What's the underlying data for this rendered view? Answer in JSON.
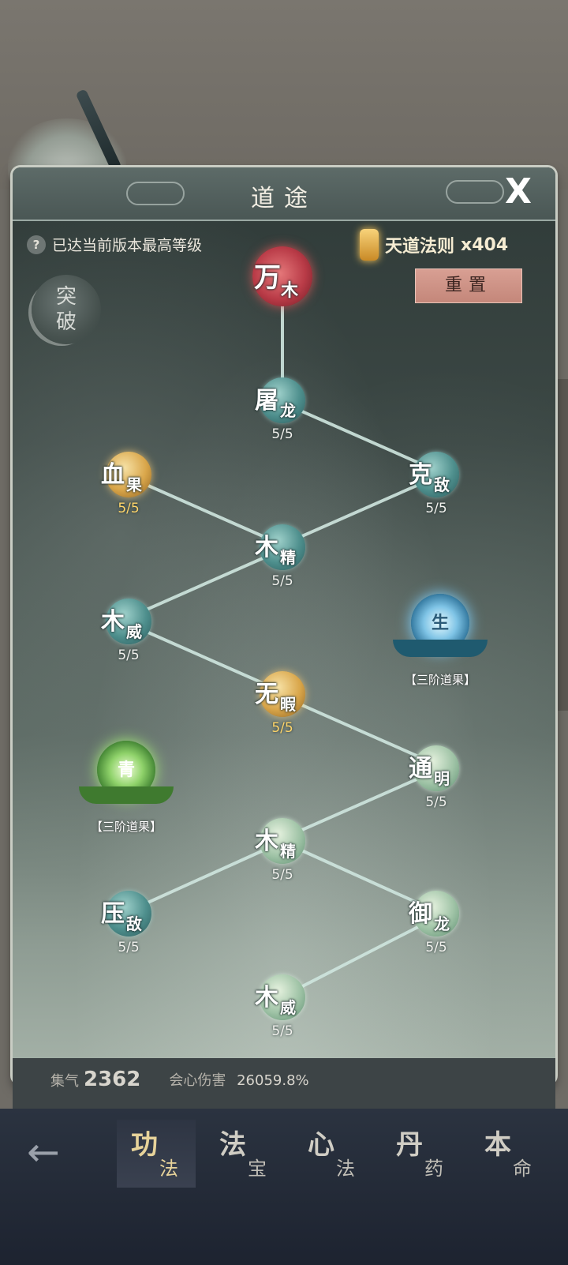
{
  "panel": {
    "title": "道途",
    "close_label": "X",
    "info_text": "已达当前版本最高等级",
    "help_icon_label": "?",
    "currency": {
      "name": "天道法则",
      "amount": "x404"
    },
    "reset_label": "重置",
    "breakthrough_top": "突",
    "breakthrough_bottom": "破"
  },
  "nodes": [
    {
      "c1": "万",
      "c2": "木",
      "level": ""
    },
    {
      "c1": "屠",
      "c2": "龙",
      "level": "5/5"
    },
    {
      "c1": "血",
      "c2": "果",
      "level": "5/5"
    },
    {
      "c1": "克",
      "c2": "敌",
      "level": "5/5"
    },
    {
      "c1": "木",
      "c2": "精",
      "level": "5/5"
    },
    {
      "c1": "木",
      "c2": "威",
      "level": "5/5"
    },
    {
      "c1": "无",
      "c2": "暇",
      "level": "5/5"
    },
    {
      "c1": "通",
      "c2": "明",
      "level": "5/5"
    },
    {
      "c1": "木",
      "c2": "精",
      "level": "5/5"
    },
    {
      "c1": "压",
      "c2": "敌",
      "level": "5/5"
    },
    {
      "c1": "御",
      "c2": "龙",
      "level": "5/5"
    },
    {
      "c1": "木",
      "c2": "威",
      "level": "5/5"
    }
  ],
  "fruits": [
    {
      "glyph": "生",
      "label": "【三阶道果】"
    },
    {
      "glyph": "青",
      "label": "【三阶道果】"
    }
  ],
  "stats": {
    "qi_label": "集气",
    "qi_value": "2362",
    "crit_label": "会心伤害",
    "crit_value": "26059.8%"
  },
  "nav": {
    "back_icon": "←",
    "tabs": [
      {
        "t1": "功",
        "t2": "法"
      },
      {
        "t1": "法",
        "t2": "宝"
      },
      {
        "t1": "心",
        "t2": "法"
      },
      {
        "t1": "丹",
        "t2": "药"
      },
      {
        "t1": "本",
        "t2": "命"
      }
    ]
  },
  "colors": {
    "panel_top": "#2f3a38",
    "panel_bottom": "#a7b4aa",
    "reset": "#d89f93",
    "currency": "#f5ecd2",
    "gold_level": "#ffd56a",
    "line": "#cfe6df"
  }
}
